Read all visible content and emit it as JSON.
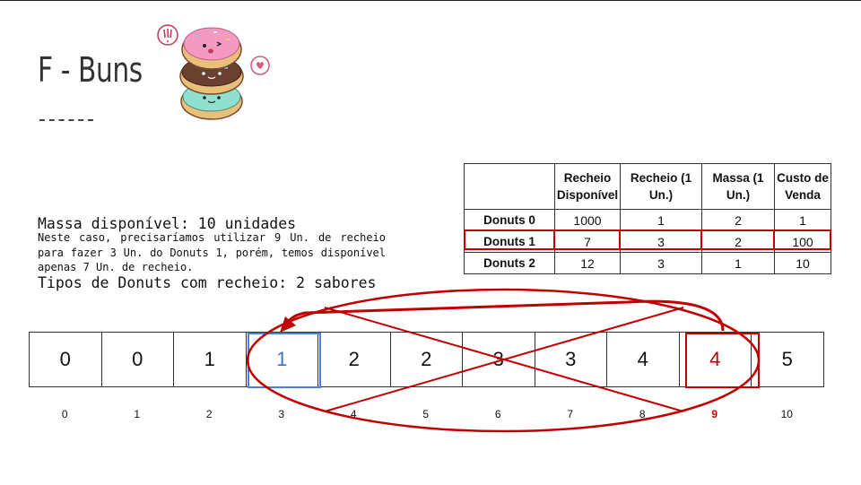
{
  "title": "F - Buns",
  "summary": {
    "line1": "Massa disponível: 10 unidades",
    "line2": "Tipos de Donuts com recheio: 2 sabores"
  },
  "note": "Neste caso, precisaríamos utilizar 9 Un. de recheio para fazer 3 Un. do Donuts 1, porém, temos disponível apenas 7 Un. de recheio.",
  "table": {
    "headers": [
      "",
      "Recheio Disponível",
      "Recheio (1 Un.)",
      "Massa (1 Un.)",
      "Custo de Venda"
    ],
    "rows": [
      [
        "Donuts 0",
        "1000",
        "1",
        "2",
        "1"
      ],
      [
        "Donuts 1",
        "7",
        "3",
        "2",
        "100"
      ],
      [
        "Donuts 2",
        "12",
        "3",
        "1",
        "10"
      ]
    ]
  },
  "array_values": [
    "0",
    "0",
    "1",
    "1",
    "2",
    "2",
    "3",
    "3",
    "4",
    "4",
    "5"
  ],
  "array_indices": [
    "0",
    "1",
    "2",
    "3",
    "4",
    "5",
    "6",
    "7",
    "8",
    "9",
    "10"
  ],
  "colors": {
    "highlight_red": "#c00000",
    "highlight_blue": "#3a6fd8"
  },
  "icons": {
    "donut_stack": "stacked-donuts-illustration"
  }
}
